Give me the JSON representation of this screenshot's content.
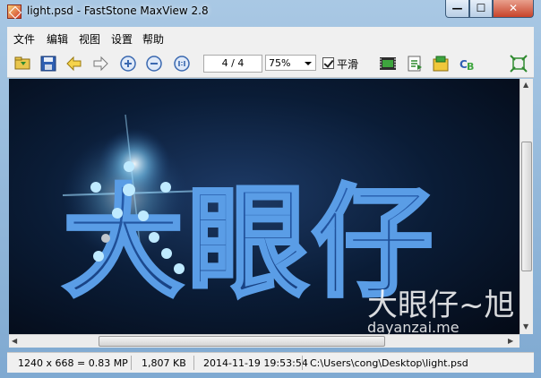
{
  "window": {
    "title": "light.psd - FastStone MaxView 2.8"
  },
  "caption": {
    "minimize": "—",
    "maximize": "☐",
    "close": "✕"
  },
  "menu": {
    "items": [
      "文件",
      "编辑",
      "视图",
      "设置",
      "帮助"
    ]
  },
  "toolbar": {
    "page_indicator": "4 / 4",
    "zoom_value": "75%",
    "smooth_label": "平滑",
    "smooth_checked": true,
    "icons": [
      "open-folder-icon",
      "save-icon",
      "previous-icon",
      "next-icon",
      "zoom-in-icon",
      "zoom-out-icon",
      "actual-size-icon",
      "slideshow-icon",
      "copy-to-icon",
      "batch-icon",
      "color-balance-icon",
      "fullscreen-icon"
    ]
  },
  "image": {
    "headline": "大眼仔",
    "watermark_top": "大眼仔~旭",
    "watermark_url": "dayanzai.me"
  },
  "status": {
    "dimensions": "1240 x 668 = 0.83 MP",
    "file_size": "1,807 KB",
    "datetime": "2014-11-19 19:53:54",
    "path": "C:\\Users\\cong\\Desktop\\light.psd"
  },
  "colors": {
    "accent": "#4fb3ff",
    "glyph": "#1f4f95",
    "background": "#0a1c36"
  }
}
